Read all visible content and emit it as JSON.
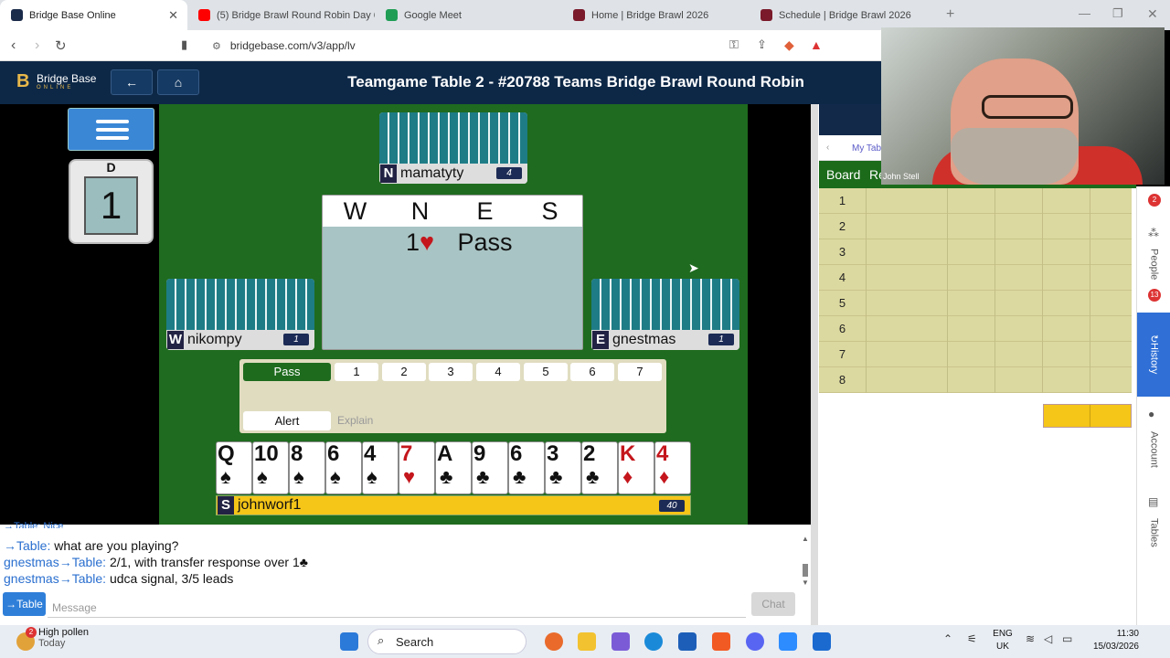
{
  "browser": {
    "tabs": [
      {
        "title": "Bridge Base Online",
        "color": "#1b2b4a"
      },
      {
        "title": "(5) Bridge Brawl Round Robin Day 6",
        "color": "#ff0000"
      },
      {
        "title": "Google Meet",
        "color": "#1f9d55"
      },
      {
        "title": "Home | Bridge Brawl 2026",
        "color": "#7a1a2a"
      },
      {
        "title": "Schedule | Bridge Brawl 2026",
        "color": "#7a1a2a"
      }
    ],
    "url": "bridgebase.com/v3/app/lv"
  },
  "header": {
    "logo_text": "Bridge Base",
    "logo_sub": "ONLINE",
    "title": "Teamgame Table 2 - #20788 Teams Bridge Brawl Round Robin"
  },
  "board": {
    "dealer": "D",
    "number": "1"
  },
  "players": {
    "north": {
      "seat": "N",
      "name": "mamatyty",
      "count": "4"
    },
    "west": {
      "seat": "W",
      "name": "nikompy",
      "count": "1"
    },
    "east": {
      "seat": "E",
      "name": "gnestmas",
      "count": "1"
    },
    "south": {
      "seat": "S",
      "name": "johnworf1",
      "count": "40"
    }
  },
  "auction": {
    "headers": [
      "W",
      "N",
      "E",
      "S"
    ],
    "bids": [
      "",
      "1♥",
      "Pass",
      ""
    ]
  },
  "bidding_box": {
    "pass": "Pass",
    "levels": [
      "1",
      "2",
      "3",
      "4",
      "5",
      "6",
      "7"
    ],
    "alert": "Alert",
    "explain": "Explain"
  },
  "south_cards": [
    {
      "rank": "Q",
      "suit": "♠",
      "color": "#111111"
    },
    {
      "rank": "10",
      "suit": "♠",
      "color": "#111111"
    },
    {
      "rank": "8",
      "suit": "♠",
      "color": "#111111"
    },
    {
      "rank": "6",
      "suit": "♠",
      "color": "#111111"
    },
    {
      "rank": "4",
      "suit": "♠",
      "color": "#111111"
    },
    {
      "rank": "7",
      "suit": "♥",
      "color": "#c4161c"
    },
    {
      "rank": "A",
      "suit": "♣",
      "color": "#111111"
    },
    {
      "rank": "9",
      "suit": "♣",
      "color": "#111111"
    },
    {
      "rank": "6",
      "suit": "♣",
      "color": "#111111"
    },
    {
      "rank": "3",
      "suit": "♣",
      "color": "#111111"
    },
    {
      "rank": "2",
      "suit": "♣",
      "color": "#111111"
    },
    {
      "rank": "K",
      "suit": "♦",
      "color": "#c4161c"
    },
    {
      "rank": "4",
      "suit": "♦",
      "color": "#c4161c"
    }
  ],
  "chat": {
    "lines": [
      {
        "who": "→Table:",
        "text": " what are you playing?"
      },
      {
        "who": "gnestmas→Table:",
        "text": " 2/1, with transfer response over 1♣"
      },
      {
        "who": "gnestmas→Table:",
        "text": " udca signal, 3/5 leads"
      }
    ],
    "target": "→Table",
    "placeholder": "Message",
    "send": "Chat"
  },
  "history": {
    "subtab": "My Tab",
    "col_board": "Board",
    "col_res": "Re",
    "rows": [
      "1",
      "2",
      "3",
      "4",
      "5",
      "6",
      "7",
      "8"
    ]
  },
  "sidebar": {
    "people": "People",
    "people_badge": "13",
    "history": "History",
    "account": "Account",
    "tables": "Tables",
    "top_badge": "2"
  },
  "webcam": {
    "name": "John Stell"
  },
  "taskbar": {
    "weather_badge": "2",
    "weather": "High pollen",
    "weather_sub": "Today",
    "search": "Search",
    "lang1": "ENG",
    "lang2": "UK",
    "time": "11:30",
    "date": "15/03/2026"
  }
}
